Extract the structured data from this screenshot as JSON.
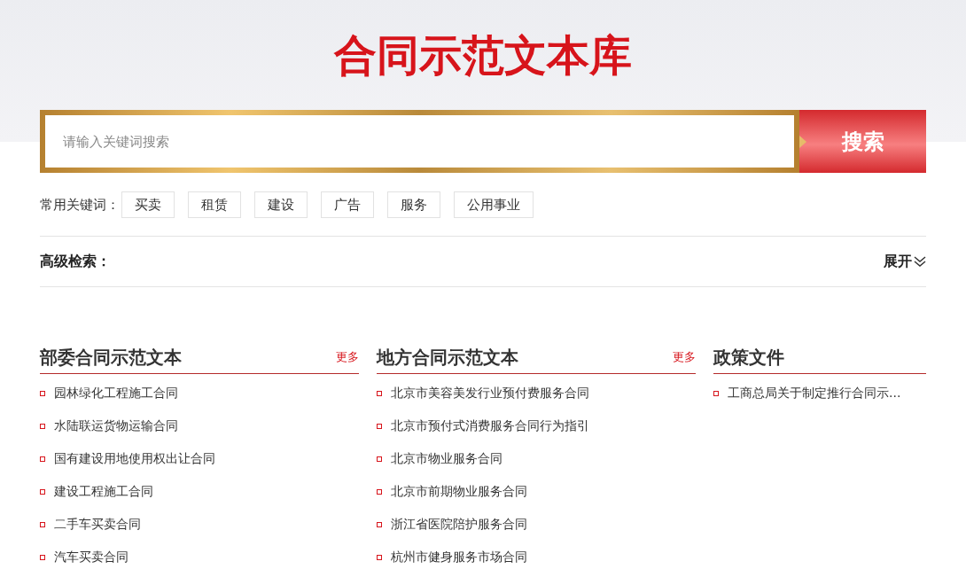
{
  "title": "合同示范文本库",
  "search": {
    "placeholder": "请输入关键词搜索",
    "button": "搜索"
  },
  "keywords": {
    "label": "常用关键词：",
    "items": [
      "买卖",
      "租赁",
      "建设",
      "广告",
      "服务",
      "公用事业"
    ]
  },
  "advanced": {
    "label": "高级检索：",
    "toggle": "展开"
  },
  "sections": [
    {
      "title": "部委合同示范文本",
      "more": "更多",
      "items": [
        "园林绿化工程施工合同",
        "水陆联运货物运输合同",
        "国有建设用地使用权出让合同",
        "建设工程施工合同",
        "二手车买卖合同",
        "汽车买卖合同"
      ]
    },
    {
      "title": "地方合同示范文本",
      "more": "更多",
      "items": [
        "北京市美容美发行业预付费服务合同",
        "北京市预付式消费服务合同行为指引",
        "北京市物业服务合同",
        "北京市前期物业服务合同",
        "浙江省医院陪护服务合同",
        "杭州市健身服务市场合同"
      ]
    },
    {
      "title": "政策文件",
      "items": [
        "工商总局关于制定推行合同示..."
      ]
    }
  ]
}
